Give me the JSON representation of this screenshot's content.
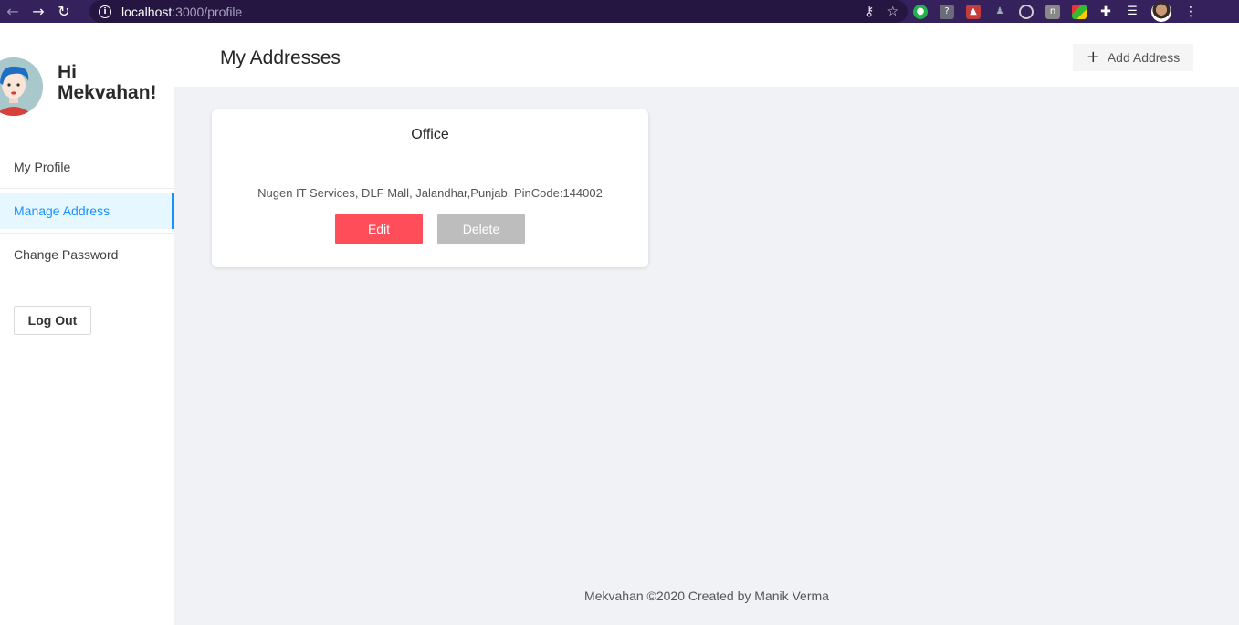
{
  "browser": {
    "url_host": "localhost",
    "url_path": ":3000/profile",
    "icons": [
      "back-icon",
      "forward-icon",
      "reload-icon",
      "info-icon",
      "key-icon",
      "star-icon",
      "extensions-icon",
      "menu-icon"
    ]
  },
  "sidebar": {
    "greeting": "Hi Mekvahan!",
    "items": [
      {
        "label": "My Profile"
      },
      {
        "label": "Manage Address"
      },
      {
        "label": "Change Password"
      }
    ],
    "logout_label": "Log Out"
  },
  "header": {
    "title": "My Addresses",
    "add_label": "Add Address"
  },
  "addresses": [
    {
      "name": "Office",
      "address": "Nugen IT Services, DLF Mall, Jalandhar,Punjab. PinCode:144002",
      "edit_label": "Edit",
      "delete_label": "Delete"
    }
  ],
  "footer": {
    "text": "Mekvahan ©2020 Created by Manik Verma"
  },
  "colors": {
    "accent": "#1890ff",
    "edit": "#ff4d5a",
    "delete": "#bdbdbd",
    "chrome": "#35215c"
  }
}
